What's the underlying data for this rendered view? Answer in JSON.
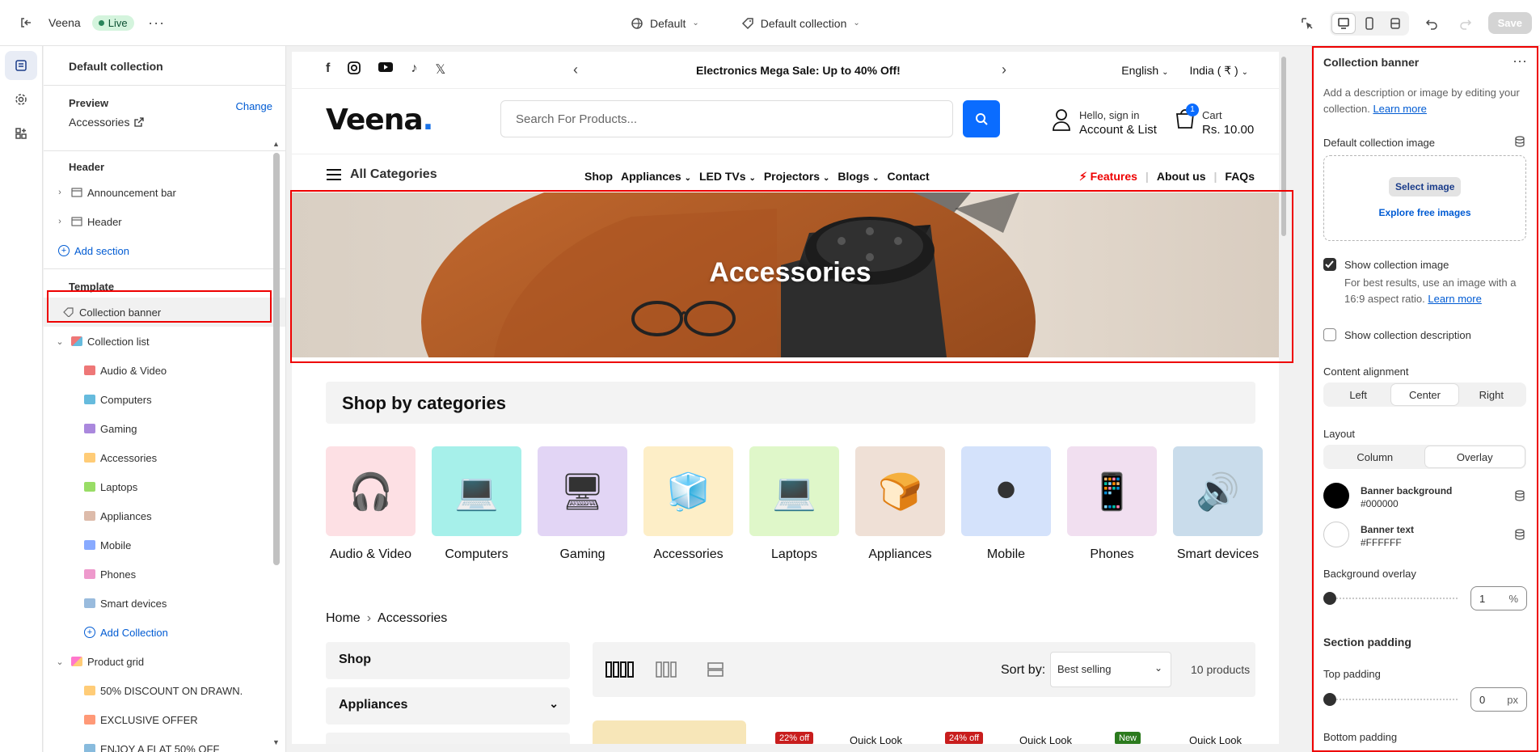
{
  "topbar": {
    "store_name": "Veena",
    "status": "Live",
    "theme_dropdown": "Default",
    "template_dropdown": "Default collection",
    "save_label": "Save"
  },
  "left_panel": {
    "title": "Default collection",
    "preview_label": "Preview",
    "preview_value": "Accessories",
    "change_label": "Change",
    "header_section": "Header",
    "header_items": [
      "Announcement bar",
      "Header"
    ],
    "add_section": "Add section",
    "template_section": "Template",
    "collection_banner": "Collection banner",
    "collection_list": "Collection list",
    "collection_children": [
      "Audio & Video",
      "Computers",
      "Gaming",
      "Accessories",
      "Laptops",
      "Appliances",
      "Mobile",
      "Phones",
      "Smart devices"
    ],
    "add_collection": "Add Collection",
    "product_grid": "Product grid",
    "product_grid_children": [
      "50% DISCOUNT ON DRAWN.",
      "EXCLUSIVE OFFER",
      "ENJOY A FLAT 50% OFF"
    ]
  },
  "store": {
    "announcement": "Electronics Mega Sale: Up to 40% Off!",
    "language": "English",
    "country": "India ( ₹ )",
    "logo": "Veena",
    "logo_dot": ".",
    "search_placeholder": "Search For Products...",
    "account_line1": "Hello, sign in",
    "account_line2": "Account & List",
    "cart_count": "1",
    "cart_label": "Cart",
    "cart_total": "Rs. 10.00",
    "all_categories": "All Categories",
    "nav_links": [
      "Shop",
      "Appliances",
      "LED TVs",
      "Projectors",
      "Blogs",
      "Contact"
    ],
    "nav_right": [
      "Features",
      "About us",
      "FAQs"
    ],
    "banner_title": "Accessories",
    "shop_by_categories": "Shop by categories",
    "categories": [
      {
        "name": "Audio & Video",
        "bg": "#fde0e4"
      },
      {
        "name": "Computers",
        "bg": "#a6f0ea"
      },
      {
        "name": "Gaming",
        "bg": "#e2d5f5"
      },
      {
        "name": "Accessories",
        "bg": "#fdeec7"
      },
      {
        "name": "Laptops",
        "bg": "#dff7c9"
      },
      {
        "name": "Appliances",
        "bg": "#efe0d6"
      },
      {
        "name": "Mobile",
        "bg": "#d4e2fb"
      },
      {
        "name": "Phones",
        "bg": "#f1dff0"
      },
      {
        "name": "Smart devices",
        "bg": "#c9dceb"
      }
    ],
    "breadcrumb_home": "Home",
    "breadcrumb_current": "Accessories",
    "filters": [
      "Shop",
      "Appliances"
    ],
    "sort_label": "Sort by:",
    "sort_value": "Best selling",
    "product_count": "10 products",
    "badges": [
      "22% off",
      "24% off",
      "New"
    ],
    "quick_look": "Quick Look"
  },
  "right_panel": {
    "title": "Collection banner",
    "description": "Add a description or image by editing your collection.",
    "learn_more": "Learn more",
    "default_image_label": "Default collection image",
    "select_image": "Select image",
    "explore_free": "Explore free images",
    "show_image_label": "Show collection image",
    "show_image_checked": true,
    "show_image_help": "For best results, use an image with a 16:9 aspect ratio.",
    "show_desc_label": "Show collection description",
    "show_desc_checked": false,
    "content_alignment": "Content alignment",
    "alignment_options": [
      "Left",
      "Center",
      "Right"
    ],
    "alignment_selected": "Center",
    "layout_label": "Layout",
    "layout_options": [
      "Column",
      "Overlay"
    ],
    "layout_selected": "Overlay",
    "banner_bg_label": "Banner background",
    "banner_bg_value": "#000000",
    "banner_text_label": "Banner text",
    "banner_text_value": "#FFFFFF",
    "overlay_label": "Background overlay",
    "overlay_value": "1",
    "overlay_unit": "%",
    "section_padding": "Section padding",
    "top_padding_label": "Top padding",
    "top_padding_value": "0",
    "padding_unit": "px",
    "bottom_padding_label": "Bottom padding"
  },
  "colors": {
    "accent": "#005bd3",
    "highlight": "#e00000",
    "search_button": "#0a6cff"
  }
}
